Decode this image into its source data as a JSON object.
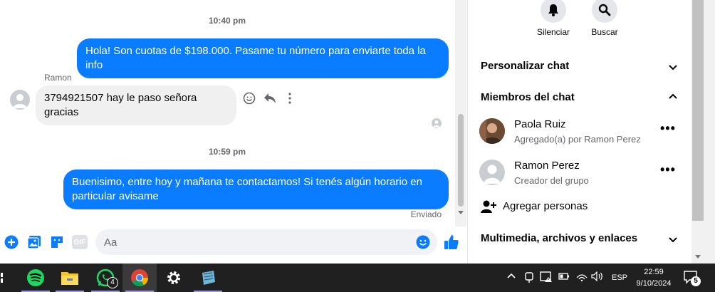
{
  "chat": {
    "messages": [
      {
        "type": "timestamp",
        "text": "10:40 pm"
      },
      {
        "type": "outgoing",
        "text": "Hola! Son cuotas de $198.000. Pasame tu número para enviarte toda la info"
      },
      {
        "type": "sender",
        "text": "Ramon"
      },
      {
        "type": "incoming",
        "text": "3794921507 hay le paso señora gracias"
      },
      {
        "type": "timestamp",
        "text": "10:59 pm"
      },
      {
        "type": "outgoing",
        "line1": "Buenisimo, entre hoy y mañana te contactamos! Si tenés algún horario en",
        "line2": "particular avisame"
      },
      {
        "type": "status",
        "text": "Enviado"
      }
    ]
  },
  "composer": {
    "placeholder": "Aa",
    "gif_label": "GIF"
  },
  "sidebar": {
    "actions": [
      {
        "label": "Silenciar",
        "icon": "bell-icon"
      },
      {
        "label": "Buscar",
        "icon": "search-icon"
      }
    ],
    "sections": {
      "customize": "Personalizar chat",
      "members": "Miembros del chat",
      "media": "Multimedia, archivos y enlaces"
    },
    "members": [
      {
        "name": "Paola Ruiz",
        "sub": "Agregado(a) por Ramon Perez"
      },
      {
        "name": "Ramon Perez",
        "sub": "Creador del grupo"
      }
    ],
    "add_people": "Agregar personas"
  },
  "taskbar": {
    "whatsapp_badge": "4",
    "lang": "ESP",
    "time": "22:59",
    "date": "9/10/2024",
    "notif_count": "5"
  },
  "colors": {
    "accent": "#0a7cff",
    "taskbar": "#202020"
  }
}
